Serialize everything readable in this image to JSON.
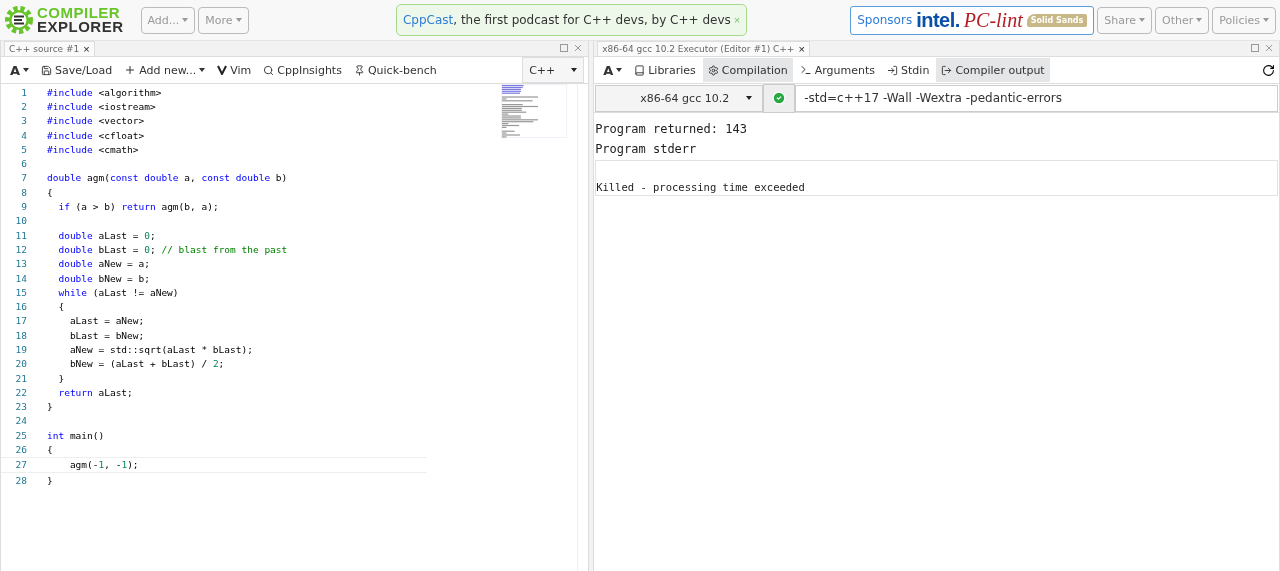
{
  "header": {
    "logo": [
      "COMPILER",
      "EXPLORER"
    ],
    "menus": [
      {
        "label": "Add..."
      },
      {
        "label": "More"
      }
    ],
    "notice": {
      "link": "CppCast",
      "text": ", the first podcast for C++ devs, by C++ devs",
      "close": "×"
    },
    "sponsors": {
      "label": "Sponsors",
      "logos": [
        "intel.",
        "PC-lint",
        "Solid Sands"
      ]
    },
    "right_menus": [
      {
        "label": "Share"
      },
      {
        "label": "Other"
      },
      {
        "label": "Policies"
      }
    ]
  },
  "editor": {
    "tab": "C++ source #1",
    "tab_close": "×",
    "toolbar": [
      {
        "kind": "font",
        "label": "A"
      },
      {
        "kind": "save",
        "label": "Save/Load"
      },
      {
        "kind": "add",
        "label": "Add new..."
      },
      {
        "kind": "vim",
        "label": "Vim"
      },
      {
        "kind": "insights",
        "label": "CppInsights"
      },
      {
        "kind": "bench",
        "label": "Quick-bench"
      }
    ],
    "language": "C++",
    "lines": [
      {
        "number": "1",
        "tokens": [
          {
            "kind": "keyword",
            "text": "#include"
          },
          {
            "kind": "plain",
            "text": " <algorithm>"
          }
        ]
      },
      {
        "number": "2",
        "tokens": [
          {
            "kind": "keyword",
            "text": "#include"
          },
          {
            "kind": "plain",
            "text": " <iostream>"
          }
        ]
      },
      {
        "number": "3",
        "tokens": [
          {
            "kind": "keyword",
            "text": "#include"
          },
          {
            "kind": "plain",
            "text": " <vector>"
          }
        ]
      },
      {
        "number": "4",
        "tokens": [
          {
            "kind": "keyword",
            "text": "#include"
          },
          {
            "kind": "plain",
            "text": " <cfloat>"
          }
        ]
      },
      {
        "number": "5",
        "tokens": [
          {
            "kind": "keyword",
            "text": "#include"
          },
          {
            "kind": "plain",
            "text": " <cmath>"
          }
        ]
      },
      {
        "number": "6"
      },
      {
        "number": "7",
        "tokens": [
          {
            "kind": "keyword",
            "text": "double"
          },
          {
            "kind": "plain",
            "text": " agm("
          },
          {
            "kind": "keyword",
            "text": "const double"
          },
          {
            "kind": "plain",
            "text": " a, "
          },
          {
            "kind": "keyword",
            "text": "const double"
          },
          {
            "kind": "plain",
            "text": " b)"
          }
        ]
      },
      {
        "number": "8",
        "tokens": [
          {
            "kind": "plain",
            "text": "{"
          }
        ]
      },
      {
        "number": "9",
        "tokens": [
          {
            "kind": "keyword",
            "text": "  if"
          },
          {
            "kind": "plain",
            "text": " (a > b) "
          },
          {
            "kind": "keyword",
            "text": "return"
          },
          {
            "kind": "plain",
            "text": " agm(b, a);"
          }
        ]
      },
      {
        "number": "10"
      },
      {
        "number": "11",
        "tokens": [
          {
            "kind": "keyword",
            "text": "  double"
          },
          {
            "kind": "plain",
            "text": " aLast = "
          },
          {
            "kind": "number",
            "text": "0"
          },
          {
            "kind": "plain",
            "text": ";"
          }
        ]
      },
      {
        "number": "12",
        "tokens": [
          {
            "kind": "keyword",
            "text": "  double"
          },
          {
            "kind": "plain",
            "text": " bLast = "
          },
          {
            "kind": "number",
            "text": "0"
          },
          {
            "kind": "plain",
            "text": "; "
          },
          {
            "kind": "comment",
            "text": "// blast from the past"
          }
        ]
      },
      {
        "number": "13",
        "tokens": [
          {
            "kind": "keyword",
            "text": "  double"
          },
          {
            "kind": "plain",
            "text": " aNew = a;"
          }
        ]
      },
      {
        "number": "14",
        "tokens": [
          {
            "kind": "keyword",
            "text": "  double"
          },
          {
            "kind": "plain",
            "text": " bNew = b;"
          }
        ]
      },
      {
        "number": "15",
        "tokens": [
          {
            "kind": "keyword",
            "text": "  while"
          },
          {
            "kind": "plain",
            "text": " (aLast != aNew)"
          }
        ]
      },
      {
        "number": "16",
        "tokens": [
          {
            "kind": "plain",
            "text": "  {"
          }
        ]
      },
      {
        "number": "17",
        "tokens": [
          {
            "kind": "plain",
            "text": "    aLast = aNew;"
          }
        ]
      },
      {
        "number": "18",
        "tokens": [
          {
            "kind": "plain",
            "text": "    bLast = bNew;"
          }
        ]
      },
      {
        "number": "19",
        "tokens": [
          {
            "kind": "plain",
            "text": "    aNew = std::sqrt(aLast * bLast);"
          }
        ]
      },
      {
        "number": "20",
        "tokens": [
          {
            "kind": "plain",
            "text": "    bNew = (aLast + bLast) / "
          },
          {
            "kind": "number",
            "text": "2"
          },
          {
            "kind": "plain",
            "text": ";"
          }
        ]
      },
      {
        "number": "21",
        "tokens": [
          {
            "kind": "plain",
            "text": "  }"
          }
        ]
      },
      {
        "number": "22",
        "tokens": [
          {
            "kind": "keyword",
            "text": "  return"
          },
          {
            "kind": "plain",
            "text": " aLast;"
          }
        ]
      },
      {
        "number": "23",
        "tokens": [
          {
            "kind": "plain",
            "text": "}"
          }
        ]
      },
      {
        "number": "24"
      },
      {
        "number": "25",
        "tokens": [
          {
            "kind": "keyword",
            "text": "int"
          },
          {
            "kind": "plain",
            "text": " main()"
          }
        ]
      },
      {
        "number": "26",
        "tokens": [
          {
            "kind": "plain",
            "text": "{"
          }
        ]
      },
      {
        "number": "27",
        "tokens": [
          {
            "kind": "plain",
            "text": "    agm(-"
          },
          {
            "kind": "number",
            "text": "1"
          },
          {
            "kind": "plain",
            "text": ", -"
          },
          {
            "kind": "number",
            "text": "1"
          },
          {
            "kind": "plain",
            "text": ");"
          }
        ]
      },
      {
        "number": "28",
        "tokens": [
          {
            "kind": "plain",
            "text": "}"
          }
        ]
      }
    ]
  },
  "executor": {
    "tab": "x86-64 gcc 10.2 Executor (Editor #1) C++",
    "tab_close": "×",
    "toolbar": [
      {
        "kind": "font",
        "label": "A",
        "selected": false
      },
      {
        "kind": "libraries",
        "label": "Libraries",
        "selected": false
      },
      {
        "kind": "compilation",
        "label": "Compilation",
        "selected": true
      },
      {
        "kind": "arguments",
        "label": "Arguments",
        "selected": false
      },
      {
        "kind": "stdin",
        "label": "Stdin",
        "selected": false
      },
      {
        "kind": "output",
        "label": "Compiler output",
        "selected": true
      }
    ],
    "compiler": "x86-64 gcc 10.2",
    "options": "-std=c++17 -Wall -Wextra -pedantic-errors",
    "output": [
      "Program returned: 143",
      "Program stderr"
    ],
    "stderr": "Killed - processing time exceeded"
  }
}
